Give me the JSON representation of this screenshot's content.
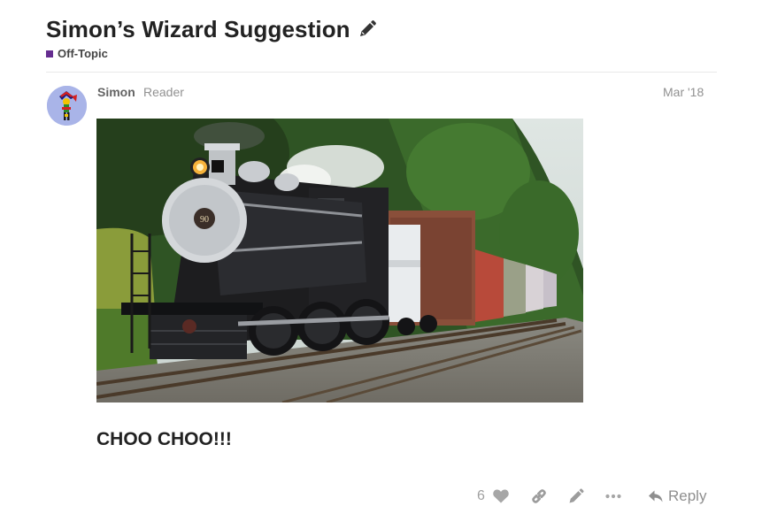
{
  "topic": {
    "title": "Simon’s Wizard Suggestion",
    "category": {
      "name": "Off-Topic",
      "color": "#652d90"
    }
  },
  "post": {
    "author": {
      "name": "Simon",
      "title": "Reader"
    },
    "date": "Mar '18",
    "body": "CHOO CHOO!!!",
    "image": {
      "description_icon": "steam-locomotive-photo"
    }
  },
  "actions": {
    "like_count": "6",
    "reply_label": "Reply"
  },
  "colors": {
    "title": "#222222",
    "muted": "#919191",
    "accent_purple": "#652d90",
    "avatar_bg": "#a9b4e8"
  }
}
